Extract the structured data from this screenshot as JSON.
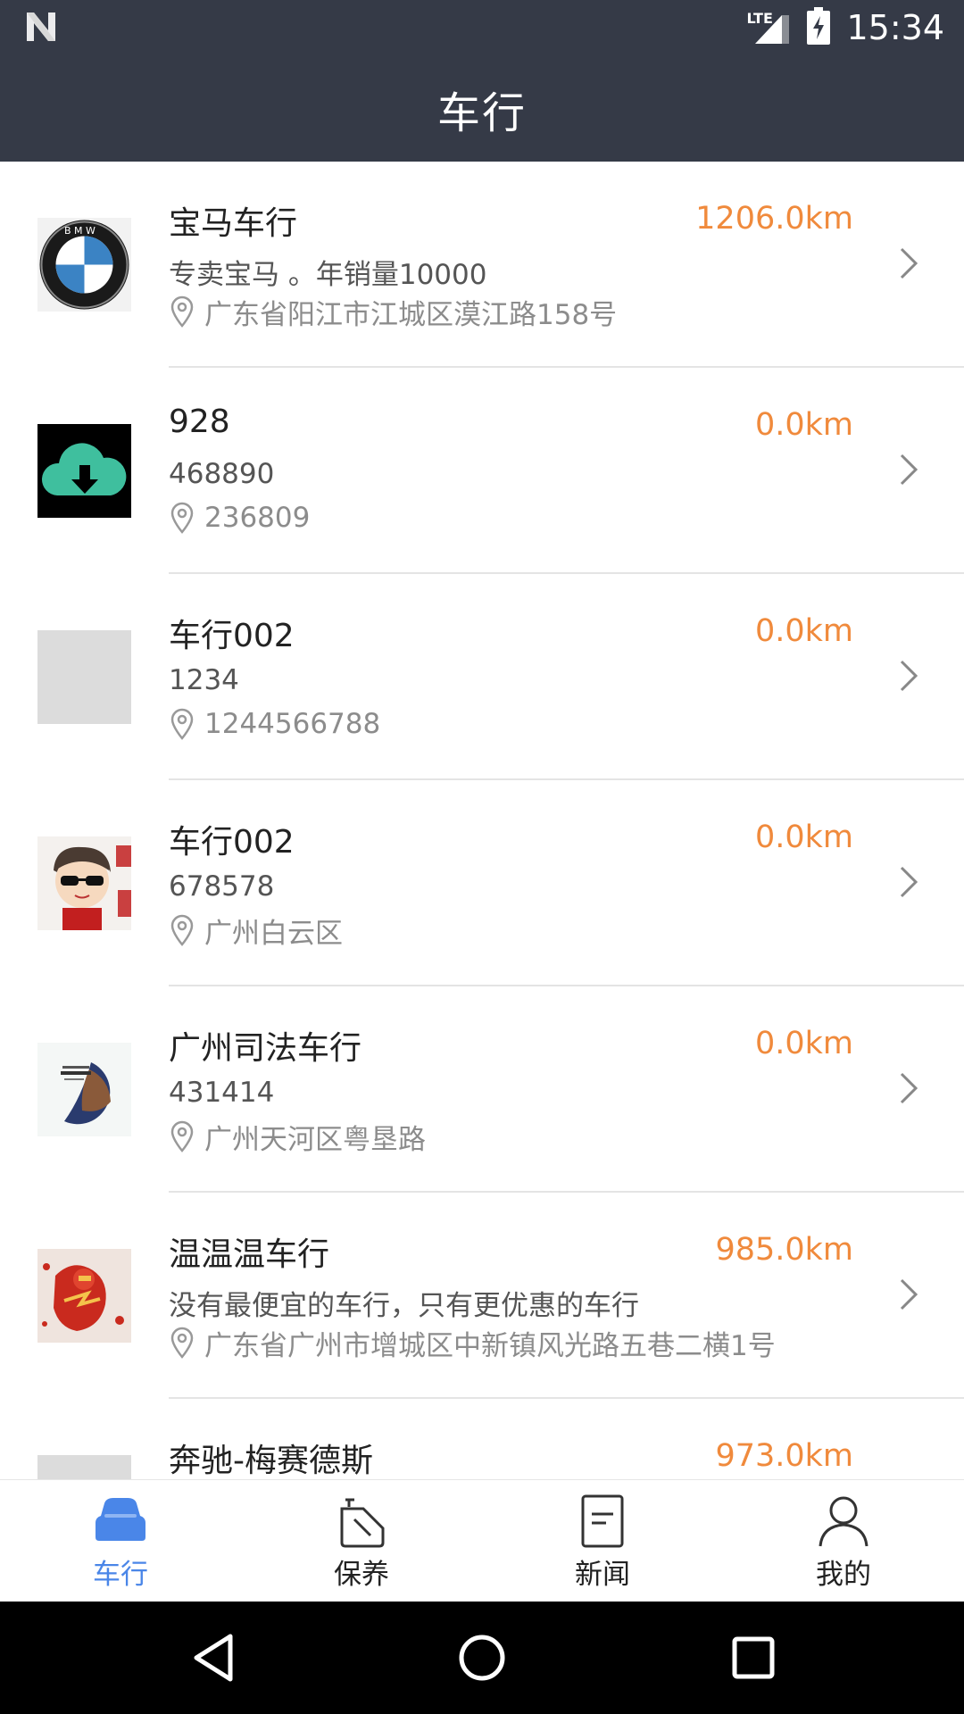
{
  "status_bar": {
    "network": "LTE",
    "time": "15:34"
  },
  "appbar": {
    "title": "车行"
  },
  "list": [
    {
      "title": "宝马车行",
      "distance": "1206.0km",
      "desc": "专卖宝马 。年销量10000",
      "address": "广东省阳江市江城区漠江路158号",
      "thumb": "bmw-logo"
    },
    {
      "title": "928",
      "distance": "0.0km",
      "desc": "468890",
      "address": "236809",
      "thumb": "cloud-download-image"
    },
    {
      "title": "车行002",
      "distance": "0.0km",
      "desc": "1234",
      "address": "1244566788",
      "thumb": "placeholder"
    },
    {
      "title": "车行002",
      "distance": "0.0km",
      "desc": "678578",
      "address": "广州白云区",
      "thumb": "cartoon-avatar"
    },
    {
      "title": "广州司法车行",
      "distance": "0.0km",
      "desc": "431414",
      "address": "广州天河区粤垦路",
      "thumb": "eason-poster"
    },
    {
      "title": "温温温车行",
      "distance": "985.0km",
      "desc": "没有最便宜的车行，只有更优惠的车行",
      "address": "广东省广州市增城区中新镇风光路五巷二横1号",
      "thumb": "flash-hero-image"
    },
    {
      "title": "奔驰-梅赛德斯",
      "distance": "973.0km",
      "desc": "",
      "address": "",
      "thumb": "placeholder"
    }
  ],
  "bottom_nav": [
    {
      "label": "车行",
      "icon": "car-icon",
      "active": true
    },
    {
      "label": "保养",
      "icon": "oil-can-icon",
      "active": false
    },
    {
      "label": "新闻",
      "icon": "news-icon",
      "active": false
    },
    {
      "label": "我的",
      "icon": "person-icon",
      "active": false
    }
  ],
  "colors": {
    "appbar_bg": "#353a47",
    "accent": "#4a86e8",
    "distance": "#f08a3c"
  }
}
